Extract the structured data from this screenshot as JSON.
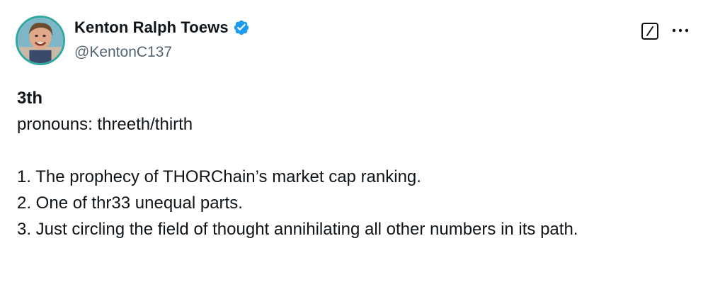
{
  "author": {
    "display_name": "Kenton Ralph Toews",
    "handle": "@KentonC137"
  },
  "tweet": {
    "headline": "3th",
    "pronouns_line": "pronouns: threeth/thirth",
    "items": [
      "1. The prophecy of THORChain’s market cap ranking.",
      "2. One of thr33 unequal parts.",
      "3. Just circling the field of thought annihilating all other numbers in its path."
    ]
  },
  "icons": {
    "verified": "verified-badge-icon",
    "grok": "grok-icon",
    "more": "more-options-icon"
  },
  "colors": {
    "verified_blue": "#1d9bf0",
    "text_primary": "#0f1419",
    "text_secondary": "#536471",
    "avatar_ring": "#2fa8a0"
  }
}
